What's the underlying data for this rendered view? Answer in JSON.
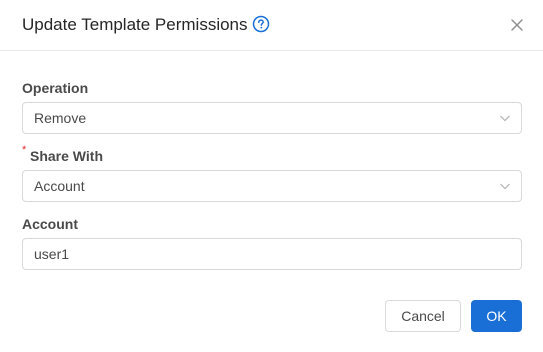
{
  "dialog": {
    "title": "Update Template Permissions"
  },
  "form": {
    "operation": {
      "label": "Operation",
      "value": "Remove"
    },
    "share_with": {
      "required_mark": "*",
      "label": "Share With",
      "value": "Account"
    },
    "account": {
      "label": "Account",
      "value": "user1"
    }
  },
  "footer": {
    "cancel_label": "Cancel",
    "ok_label": "OK"
  },
  "colors": {
    "primary": "#1a6fd6",
    "required": "#e0282e",
    "border": "#d9d9d9"
  },
  "icons": {
    "help": "question-circle-icon",
    "close": "close-icon",
    "dropdown": "chevron-down-icon"
  }
}
